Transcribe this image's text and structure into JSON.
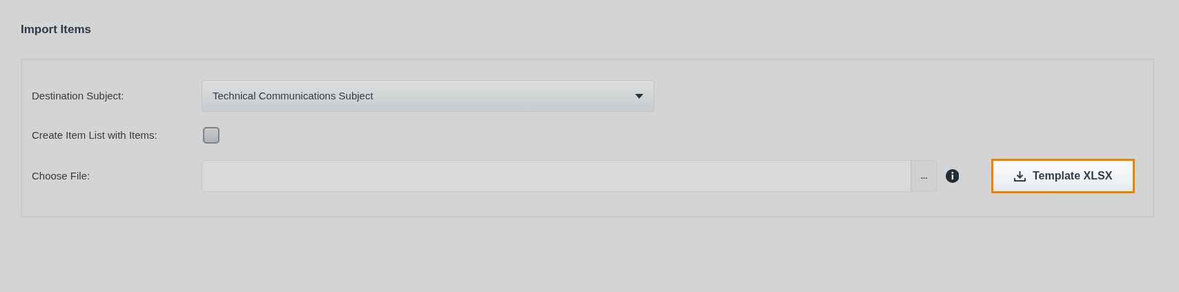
{
  "title": "Import Items",
  "fields": [
    {
      "kind": "select",
      "label": "Destination Subject:",
      "value": "Technical Communications Subject"
    },
    {
      "kind": "checkbox",
      "label": "Create Item List with Items:",
      "checked": false
    },
    {
      "kind": "file",
      "label": "Choose File:",
      "browse": "...",
      "button": "Template XLSX"
    }
  ]
}
